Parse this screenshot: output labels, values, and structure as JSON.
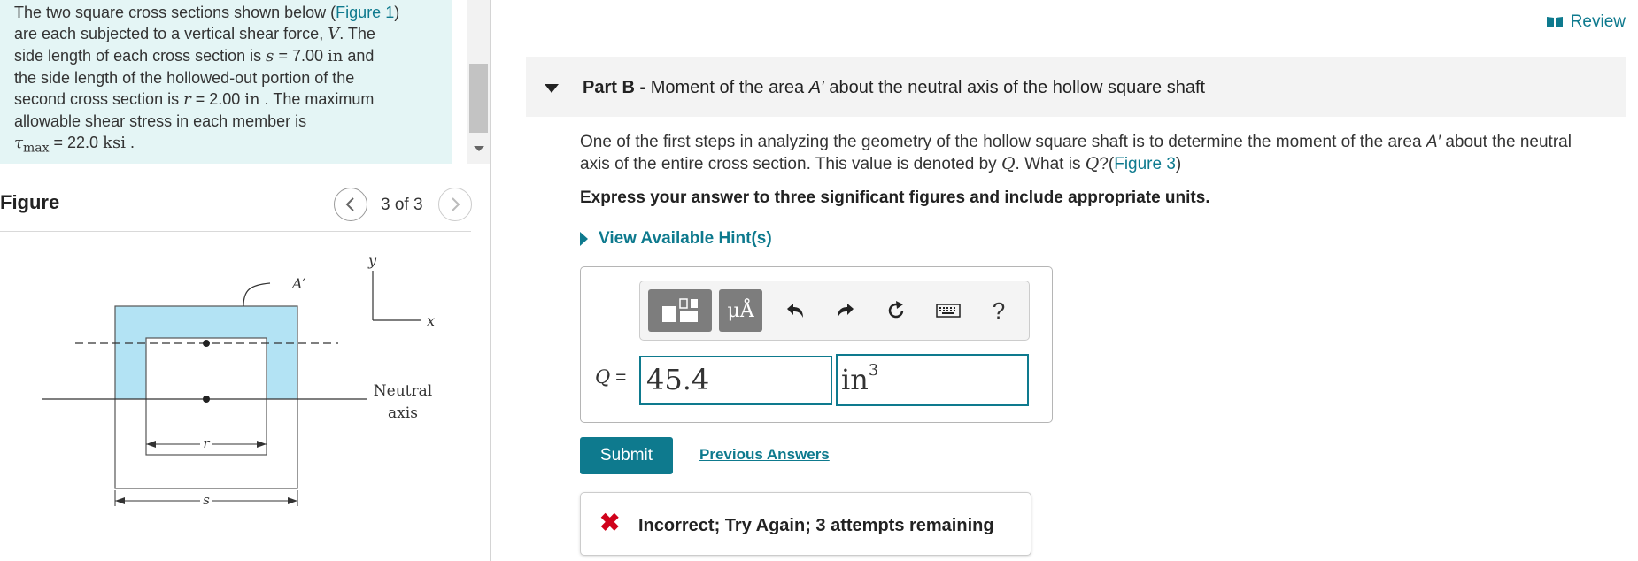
{
  "problem": {
    "line1_a": "The two square cross sections shown below (",
    "fig1_link": "Figure 1",
    "line1_b": ")",
    "line2_a": "are each subjected to a vertical shear force,",
    "V": "V",
    "line2_b": ". The",
    "line3_a": "side length of each cross section is",
    "s_sym": "s",
    "s_val": "= 7.00",
    "unit_in": "in",
    "line3_b": "and",
    "line4": "the side length of the hollowed-out portion of the",
    "line5_a": "second cross section is",
    "r_sym": "r",
    "r_val": "= 2.00",
    "line5_b": ". The maximum",
    "line6": "allowable shear stress in each member is",
    "tau": "τ",
    "tau_sub": "max",
    "tau_val": "= 22.0",
    "ksi": "ksi",
    "line7_end": "."
  },
  "figure_panel": {
    "title": "Figure",
    "counter": "3 of 3",
    "labels": {
      "a_prime": "A′",
      "y": "y",
      "x": "x",
      "neutral_1": "Neutral",
      "neutral_2": "axis",
      "r": "r",
      "s": "s"
    },
    "fill_color": "#b3e3f4"
  },
  "header": {
    "review": "Review"
  },
  "part_b": {
    "prefix": "Part B -",
    "title_a": "Moment of the area",
    "title_sym": "A′",
    "title_b": "about the neutral axis of the hollow square shaft"
  },
  "question": {
    "line1_a": "One of the first steps in analyzing the geometry of the hollow square shaft is to determine the moment of the area",
    "sym_a": "A′",
    "line1_b": "about the neutral",
    "line2_a": "axis of the entire cross section. This value is denoted by",
    "sym_q": "Q",
    "line2_b": ". What is",
    "line2_c": "?(",
    "fig3_link": "Figure 3",
    "line2_d": ")"
  },
  "instruction": "Express your answer to three significant figures and include appropriate units.",
  "hints_label": "View Available Hint(s)",
  "toolbar": {
    "mu_label": "μÅ",
    "help_label": "?"
  },
  "answer": {
    "q_symbol": "Q",
    "equals": "=",
    "value": "45.4",
    "unit": "in",
    "unit_exp": "3"
  },
  "actions": {
    "submit": "Submit",
    "previous": "Previous Answers"
  },
  "feedback": {
    "icon": "✖",
    "text": "Incorrect; Try Again; 3 attempts remaining"
  },
  "colors": {
    "accent": "#0e7a8e",
    "problem_bg": "#e4f5f5",
    "error": "#d0021b"
  }
}
